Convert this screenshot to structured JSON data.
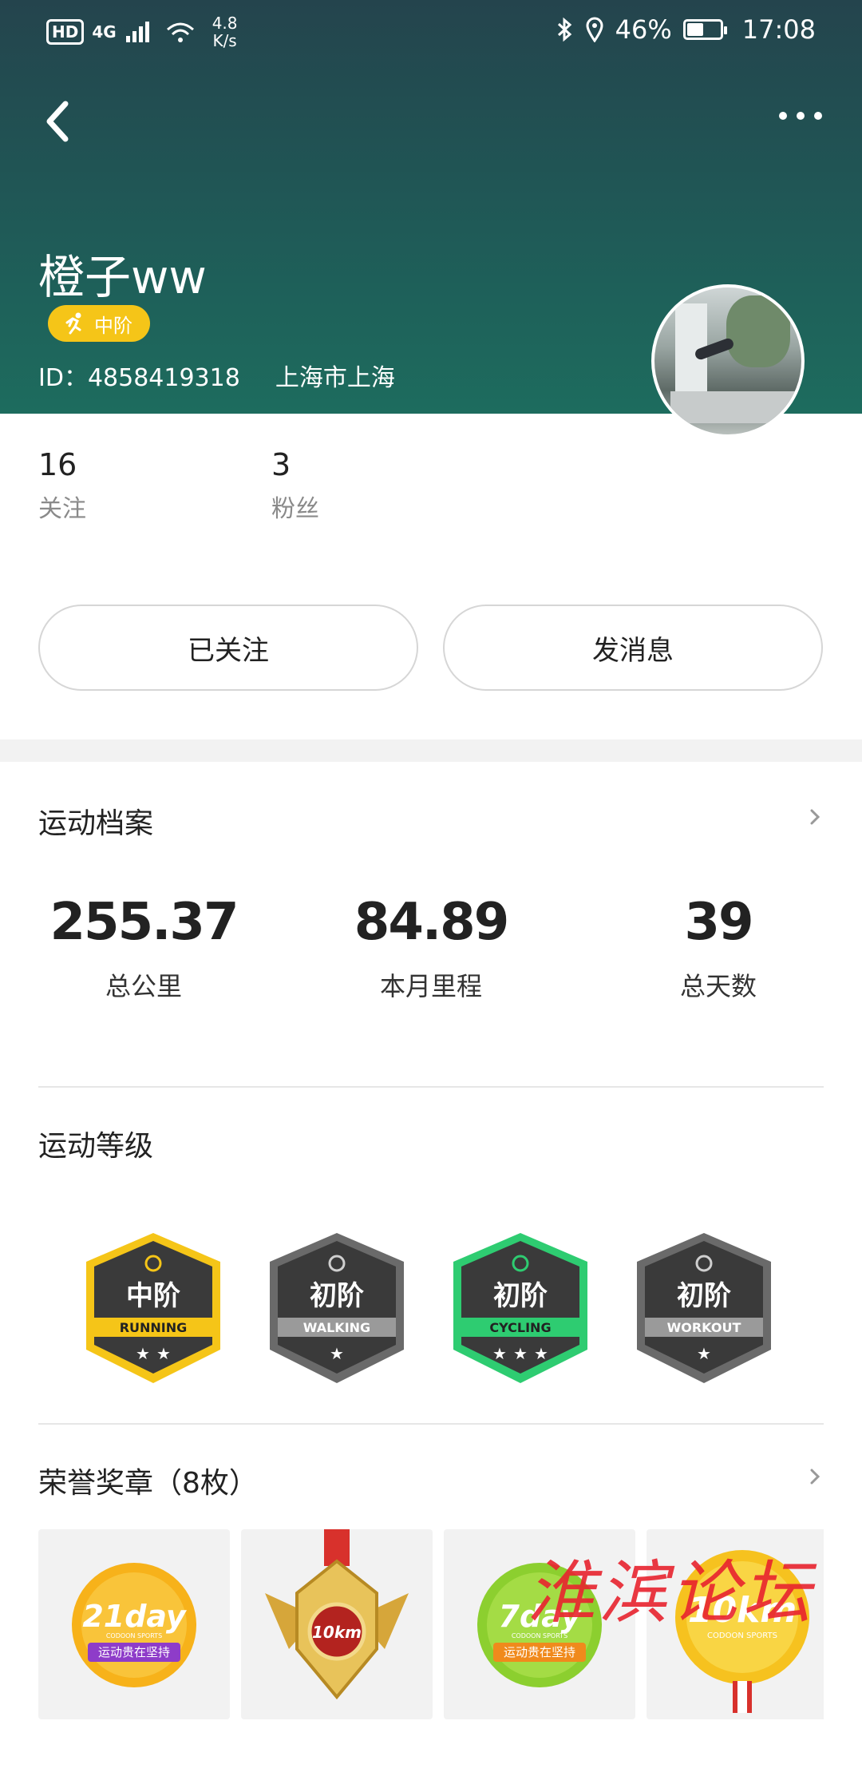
{
  "status_bar": {
    "hd": "HD",
    "network": "4G",
    "speed_value": "4.8",
    "speed_unit": "K/s",
    "battery": "46%",
    "time": "17:08"
  },
  "profile": {
    "name": "橙子ww",
    "level_label": "中阶",
    "id_label": "ID：4858419318",
    "location": "上海市上海"
  },
  "social": {
    "following_count": "16",
    "following_label": "关注",
    "followers_count": "3",
    "followers_label": "粉丝"
  },
  "actions": {
    "follow_label": "已关注",
    "message_label": "发消息"
  },
  "sports_profile": {
    "title": "运动档案",
    "total_km": "255.37",
    "total_km_label": "总公里",
    "month_km": "84.89",
    "month_km_label": "本月里程",
    "total_days": "39",
    "total_days_label": "总天数"
  },
  "sports_level": {
    "title": "运动等级",
    "badges": [
      {
        "level": "中阶",
        "sport": "RUNNING",
        "stars": 2,
        "color": "#f5c518"
      },
      {
        "level": "初阶",
        "sport": "WALKING",
        "stars": 1,
        "color": "#8a8a8a"
      },
      {
        "level": "初阶",
        "sport": "CYCLING",
        "stars": 3,
        "color": "#2ecc71"
      },
      {
        "level": "初阶",
        "sport": "WORKOUT",
        "stars": 1,
        "color": "#8a8a8a"
      }
    ]
  },
  "honor_medals": {
    "title": "荣誉奖章（8枚）",
    "medals": [
      {
        "name": "21day",
        "caption": "运动贵在坚持",
        "sub": "CODOON SPORTS"
      },
      {
        "name": "10km",
        "caption": "",
        "sub": ""
      },
      {
        "name": "7day",
        "caption": "运动贵在坚持",
        "sub": "CODOON SPORTS"
      },
      {
        "name": "10km",
        "caption": "",
        "sub": "CODOON SPORTS"
      }
    ]
  },
  "watermark": "淮滨论坛",
  "colors": {
    "header_top": "#24444d",
    "header_bottom": "#1d6c5e",
    "accent_yellow": "#f5c518",
    "accent_green": "#2ecc71"
  }
}
